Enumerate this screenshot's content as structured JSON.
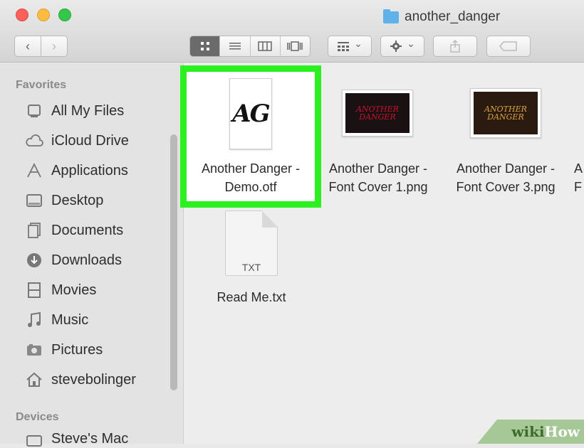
{
  "window": {
    "title": "another_danger"
  },
  "toolbar": {
    "back": "‹",
    "forward": "›",
    "arrange_chevron": "⌄",
    "action_chevron": "⌄"
  },
  "sidebar": {
    "favorites_heading": "Favorites",
    "devices_heading": "Devices",
    "items": [
      {
        "label": "All My Files",
        "icon": "all-files-icon"
      },
      {
        "label": "iCloud Drive",
        "icon": "cloud-icon"
      },
      {
        "label": "Applications",
        "icon": "applications-icon"
      },
      {
        "label": "Desktop",
        "icon": "desktop-icon"
      },
      {
        "label": "Documents",
        "icon": "documents-icon"
      },
      {
        "label": "Downloads",
        "icon": "downloads-icon"
      },
      {
        "label": "Movies",
        "icon": "movies-icon"
      },
      {
        "label": "Music",
        "icon": "music-icon"
      },
      {
        "label": "Pictures",
        "icon": "pictures-icon"
      },
      {
        "label": "stevebolinger",
        "icon": "home-icon"
      }
    ],
    "devices": [
      {
        "label": "Steve's Mac",
        "icon": "computer-icon"
      }
    ]
  },
  "files": [
    {
      "line1": "Another Danger -",
      "line2": "Demo.otf",
      "thumb_text": "AG"
    },
    {
      "line1": "Another Danger -",
      "line2": "Font Cover 1.png",
      "thumb_text": "ANOTHER DANGER"
    },
    {
      "line1": "Another Danger -",
      "line2": "Font Cover 3.png",
      "thumb_text": "ANOTHER DANGER"
    },
    {
      "line1": "A",
      "line2": "F"
    },
    {
      "line1": "Read Me.txt",
      "thumb_text": "TXT"
    }
  ],
  "watermark": {
    "wiki": "wiki",
    "how": "How"
  },
  "colors": {
    "highlight": "#2cf01f",
    "accent_folder": "#5fb2e8"
  }
}
